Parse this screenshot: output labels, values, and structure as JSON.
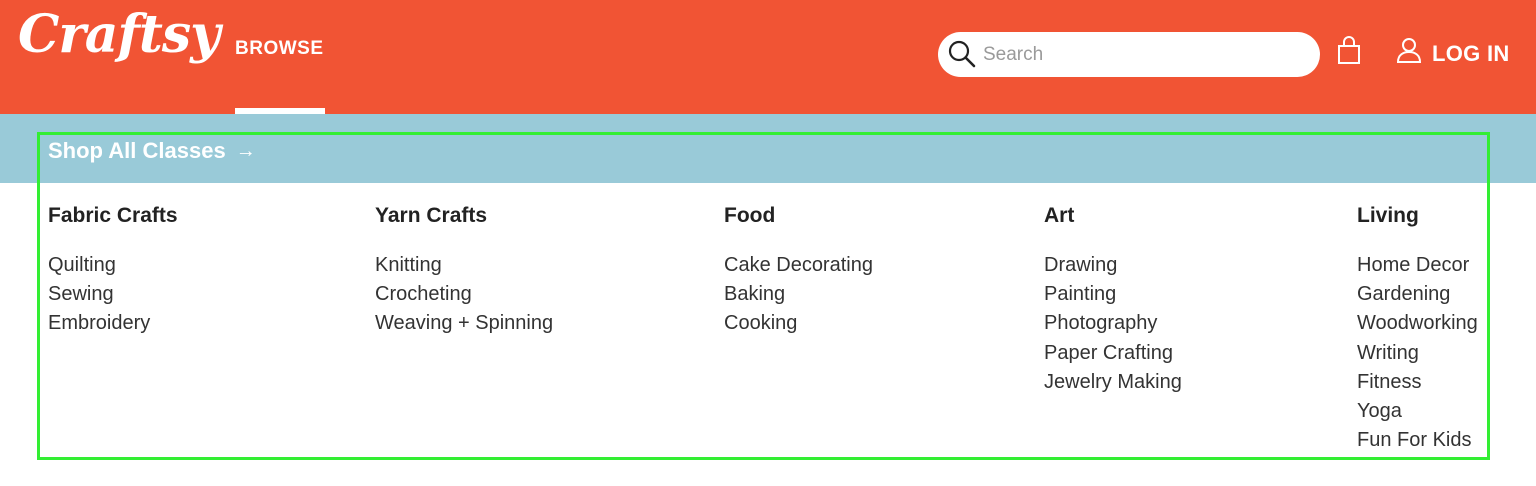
{
  "header": {
    "logo_text": "Craftsy",
    "browse_label": "BROWSE",
    "search": {
      "placeholder": "Search",
      "value": ""
    },
    "cart_icon": "shopping-bag-icon",
    "login_label": "LOG IN",
    "colors": {
      "brand": "#f15434",
      "text": "#ffffff"
    }
  },
  "menu": {
    "shop_all_label": "Shop All Classes",
    "shop_all_arrow": "→",
    "bar_color": "#99cad8",
    "columns": [
      {
        "heading": "Fabric Crafts",
        "items": [
          "Quilting",
          "Sewing",
          "Embroidery"
        ]
      },
      {
        "heading": "Yarn Crafts",
        "items": [
          "Knitting",
          "Crocheting",
          "Weaving + Spinning"
        ]
      },
      {
        "heading": "Food",
        "items": [
          "Cake Decorating",
          "Baking",
          "Cooking"
        ]
      },
      {
        "heading": "Art",
        "items": [
          "Drawing",
          "Painting",
          "Photography",
          "Paper Crafting",
          "Jewelry Making"
        ]
      },
      {
        "heading": "Living",
        "items": [
          "Home Decor",
          "Gardening",
          "Woodworking",
          "Writing",
          "Fitness",
          "Yoga",
          "Fun For Kids"
        ]
      }
    ]
  },
  "highlight_color": "#33ee33"
}
